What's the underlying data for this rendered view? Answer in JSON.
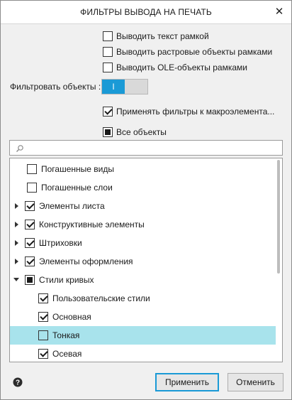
{
  "dialog": {
    "title": "ФИЛЬТРЫ ВЫВОДА НА ПЕЧАТЬ",
    "close_glyph": "✕"
  },
  "options": [
    {
      "label": "Выводить текст рамкой",
      "state": "unchecked"
    },
    {
      "label": "Выводить растровые объекты рамками",
      "state": "unchecked"
    },
    {
      "label": "Выводить OLE-объекты рамками",
      "state": "unchecked"
    }
  ],
  "filter_objects": {
    "label": "Фильтровать объекты :",
    "toggle_text": "I",
    "state": "on"
  },
  "apply_to_macro": {
    "label": "Применять фильтры к макроэлемента...",
    "state": "checked"
  },
  "all_objects": {
    "label": "Все объекты",
    "state": "partial"
  },
  "search": {
    "placeholder": "",
    "value": ""
  },
  "tree": [
    {
      "label": "Погашенные виды",
      "state": "unchecked",
      "expander": "none",
      "selected": false
    },
    {
      "label": "Погашенные слои",
      "state": "unchecked",
      "expander": "none",
      "selected": false
    },
    {
      "label": "Элементы листа",
      "state": "checked",
      "expander": "collapsed",
      "selected": false
    },
    {
      "label": "Конструктивные элементы",
      "state": "checked",
      "expander": "collapsed",
      "selected": false
    },
    {
      "label": "Штриховки",
      "state": "checked",
      "expander": "collapsed",
      "selected": false
    },
    {
      "label": "Элементы оформления",
      "state": "checked",
      "expander": "collapsed",
      "selected": false
    },
    {
      "label": "Стили кривых",
      "state": "partial",
      "expander": "expanded",
      "selected": false
    },
    {
      "label": "Пользовательские стили",
      "state": "checked",
      "expander": "none",
      "selected": false
    },
    {
      "label": "Основная",
      "state": "checked",
      "expander": "none",
      "selected": false
    },
    {
      "label": "Тонкая",
      "state": "unchecked",
      "expander": "none",
      "selected": true
    },
    {
      "label": "Осевая",
      "state": "checked",
      "expander": "none",
      "selected": false
    }
  ],
  "footer": {
    "help_icon": "question-circle-icon",
    "apply_label": "Применить",
    "cancel_label": "Отменить"
  },
  "colors": {
    "accent": "#1a9ad6",
    "selection": "#a8e3ec"
  }
}
